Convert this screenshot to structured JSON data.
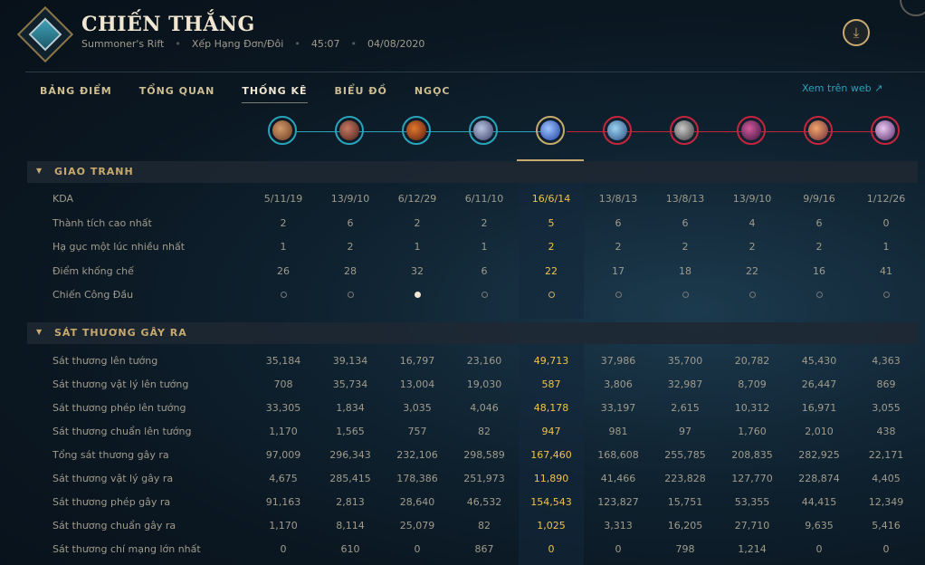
{
  "header": {
    "title": "CHIẾN THẮNG",
    "map": "Summoner's Rift",
    "queue": "Xếp Hạng Đơn/Đôi",
    "duration": "45:07",
    "date": "04/08/2020",
    "download_icon": "download-icon"
  },
  "tabs": [
    "BẢNG ĐIỂM",
    "TỔNG QUAN",
    "THỐNG KÊ",
    "BIỂU ĐỒ",
    "NGỌC"
  ],
  "active_tab": "THỐNG KÊ",
  "web_link": "Xem trên web ↗",
  "colors": {
    "blue_team": "#2aa3bb",
    "red_team": "#c4253c",
    "highlight": "#f0c24a",
    "gold": "#c8aa6e"
  },
  "sections": {
    "combat": {
      "title": "GIAO TRANH",
      "rows": [
        {
          "label": "KDA",
          "values": [
            "5/11/19",
            "13/9/10",
            "6/12/29",
            "6/11/10",
            "16/6/14",
            "13/8/13",
            "13/8/13",
            "13/9/10",
            "9/9/16",
            "1/12/26"
          ]
        },
        {
          "label": "Thành tích cao nhất",
          "values": [
            "2",
            "6",
            "2",
            "2",
            "5",
            "6",
            "6",
            "4",
            "6",
            "0"
          ]
        },
        {
          "label": "Hạ gục một lúc nhiều nhất",
          "values": [
            "1",
            "2",
            "1",
            "1",
            "2",
            "2",
            "2",
            "2",
            "2",
            "1"
          ]
        },
        {
          "label": "Điểm khống chế",
          "values": [
            "26",
            "28",
            "32",
            "6",
            "22",
            "17",
            "18",
            "22",
            "16",
            "41"
          ]
        },
        {
          "label": "Chiến Công Đầu",
          "values": [
            "",
            "",
            "",
            "",
            "",
            "",
            "",
            "",
            "",
            ""
          ]
        }
      ]
    },
    "damage": {
      "title": "SÁT THƯƠNG GÂY RA",
      "rows": [
        {
          "label": "Sát thương lên tướng",
          "values": [
            "35,184",
            "39,134",
            "16,797",
            "23,160",
            "49,713",
            "37,986",
            "35,700",
            "20,782",
            "45,430",
            "4,363"
          ]
        },
        {
          "label": "Sát thương vật lý lên tướng",
          "values": [
            "708",
            "35,734",
            "13,004",
            "19,030",
            "587",
            "3,806",
            "32,987",
            "8,709",
            "26,447",
            "869"
          ]
        },
        {
          "label": "Sát thương phép lên tướng",
          "values": [
            "33,305",
            "1,834",
            "3,035",
            "4,046",
            "48,178",
            "33,197",
            "2,615",
            "10,312",
            "16,971",
            "3,055"
          ]
        },
        {
          "label": "Sát thương chuẩn lên tướng",
          "values": [
            "1,170",
            "1,565",
            "757",
            "82",
            "947",
            "981",
            "97",
            "1,760",
            "2,010",
            "438"
          ]
        },
        {
          "label": "Tổng sát thương gây ra",
          "values": [
            "97,009",
            "296,343",
            "232,106",
            "298,589",
            "167,460",
            "168,608",
            "255,785",
            "208,835",
            "282,925",
            "22,171"
          ]
        },
        {
          "label": "Sát thương vật lý gây ra",
          "values": [
            "4,675",
            "285,415",
            "178,386",
            "251,973",
            "11,890",
            "41,466",
            "223,828",
            "127,770",
            "228,874",
            "4,405"
          ]
        },
        {
          "label": "Sát thương phép gây ra",
          "values": [
            "91,163",
            "2,813",
            "28,640",
            "46,532",
            "154,543",
            "123,827",
            "15,751",
            "53,355",
            "44,415",
            "12,349"
          ]
        },
        {
          "label": "Sát thương chuẩn gây ra",
          "values": [
            "1,170",
            "8,114",
            "25,079",
            "82",
            "1,025",
            "3,313",
            "16,205",
            "27,710",
            "9,635",
            "5,416"
          ]
        },
        {
          "label": "Sát thương chí mạng lớn nhất",
          "values": [
            "0",
            "610",
            "0",
            "867",
            "0",
            "0",
            "798",
            "1,214",
            "0",
            "0"
          ]
        }
      ]
    }
  }
}
